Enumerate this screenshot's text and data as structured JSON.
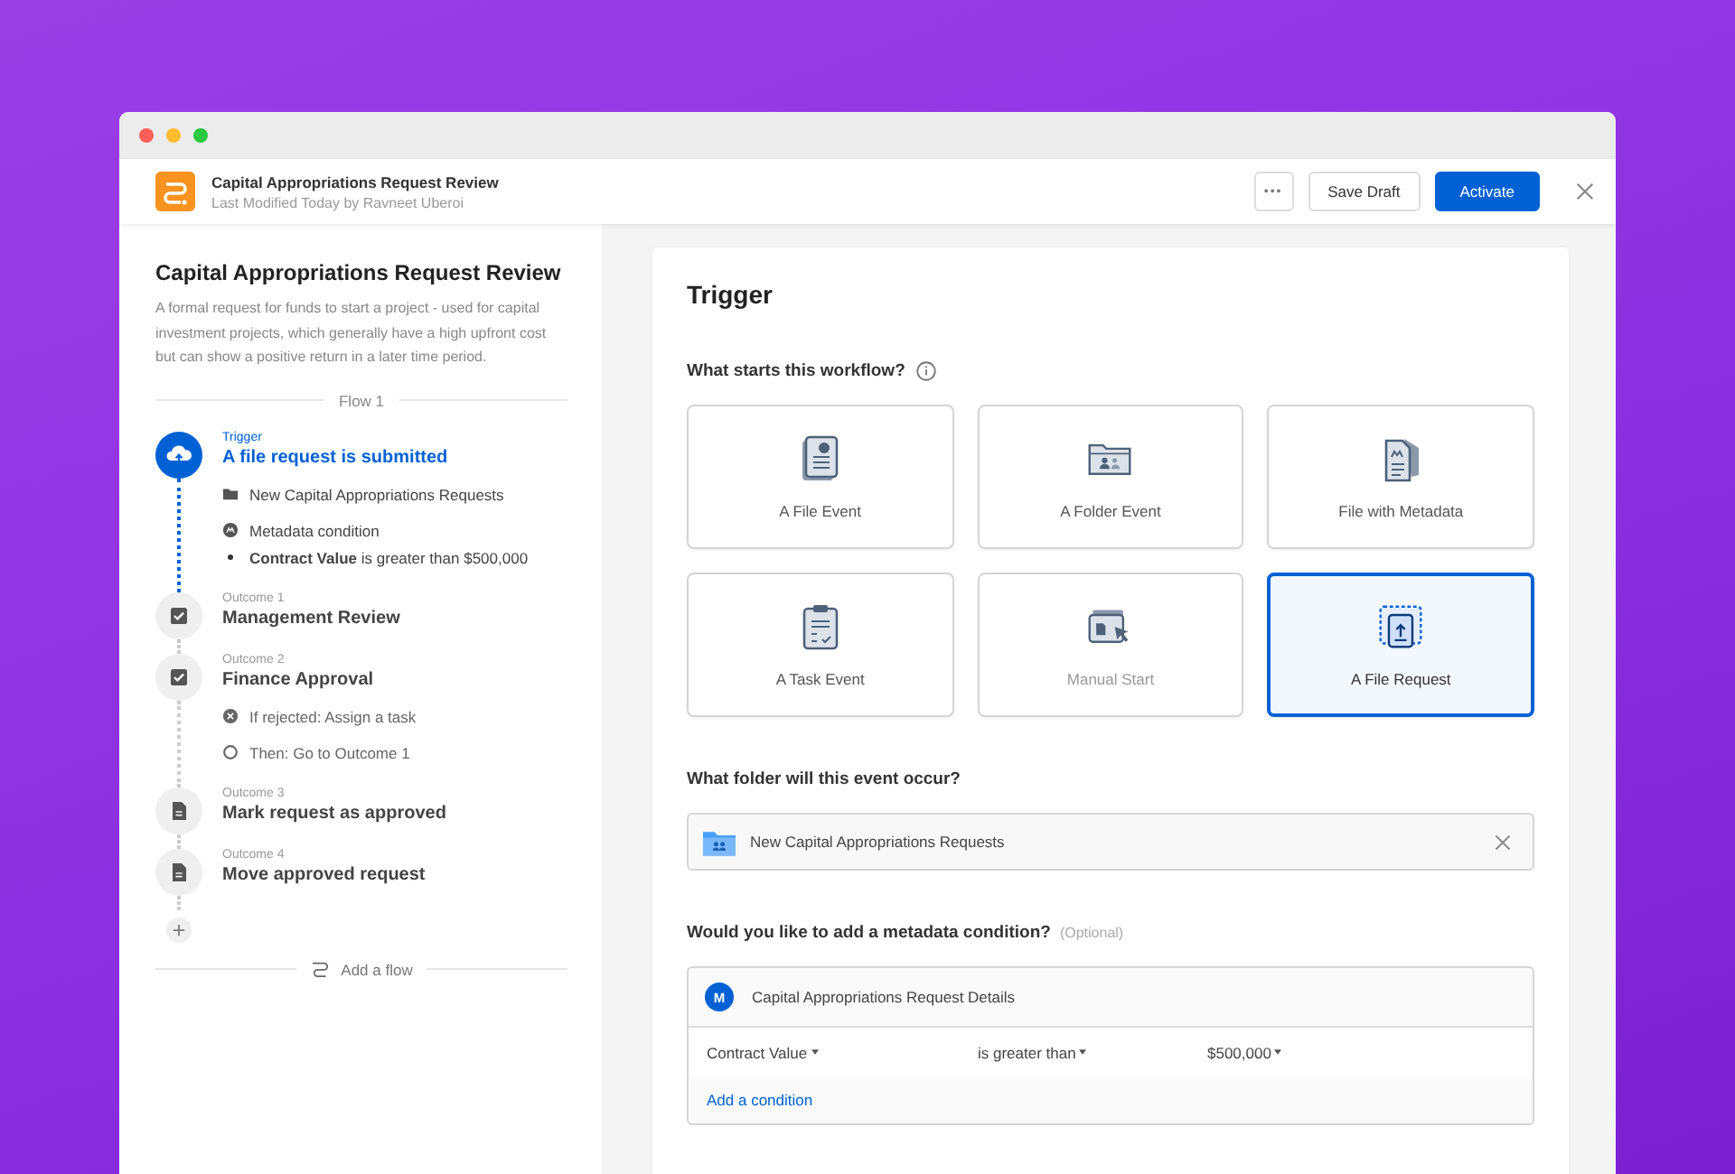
{
  "header": {
    "title": "Capital Appropriations Request Review",
    "subtitle": "Last Modified Today by Ravneet Uberoi",
    "more_label": "•••",
    "buttons": [
      {
        "label": "Save Draft",
        "kind": "secondary"
      },
      {
        "label": "Activate",
        "kind": "primary"
      }
    ]
  },
  "sidebar": {
    "title": "Capital Appropriations Request Review",
    "description": "A formal request for funds to start a project - used for capital investment projects, which generally have a high upfront cost but can show a positive return in a later time period.",
    "flow_label": "Flow 1",
    "steps": [
      {
        "kind": "trigger",
        "label": "Trigger",
        "title": "A file request is submitted",
        "details": [
          {
            "kind": "folder",
            "text": "New Capital Appropriations Requests"
          },
          {
            "kind": "metadata",
            "text": "Metadata condition"
          },
          {
            "kind": "bullet",
            "text": "**Contract Value** is greater than $500,000"
          }
        ]
      },
      {
        "kind": "task",
        "label": "Outcome 1",
        "title": "Management Review"
      },
      {
        "kind": "task",
        "label": "Outcome 2",
        "title": "Finance Approval",
        "details": [
          {
            "kind": "rejected",
            "text": "If rejected: Assign a task"
          },
          {
            "kind": "then",
            "text": "Then: Go to Outcome 1"
          }
        ]
      },
      {
        "kind": "doc",
        "label": "Outcome 3",
        "title": "Mark request as approved"
      },
      {
        "kind": "doc",
        "label": "Outcome 4",
        "title": "Move approved request"
      }
    ],
    "add_flow": "Add a flow"
  },
  "main": {
    "title": "Trigger",
    "question": "What starts this workflow?",
    "options": [
      {
        "kind": "file",
        "label": "A File Event",
        "selected": false,
        "disabled": false
      },
      {
        "kind": "folder",
        "label": "A Folder Event",
        "selected": false,
        "disabled": false
      },
      {
        "kind": "metadata",
        "label": "File with Metadata",
        "selected": false,
        "disabled": false
      },
      {
        "kind": "task",
        "label": "A Task Event",
        "selected": false,
        "disabled": false
      },
      {
        "kind": "manual",
        "label": "Manual Start",
        "selected": false,
        "disabled": true
      },
      {
        "kind": "request",
        "label": "A File Request",
        "selected": true,
        "disabled": false
      }
    ],
    "folder_question": "What folder will this event occur?",
    "folder_value": "New Capital Appropriations Requests",
    "metadata_question": "Would you like to add a metadata condition?",
    "metadata_optional": "(Optional)",
    "template": {
      "badge": "M",
      "name": "Capital Appropriations Request Details"
    },
    "condition": {
      "field": "Contract Value",
      "operator": "is greater than",
      "value": "$500,000"
    },
    "add_condition": "Add a condition"
  }
}
